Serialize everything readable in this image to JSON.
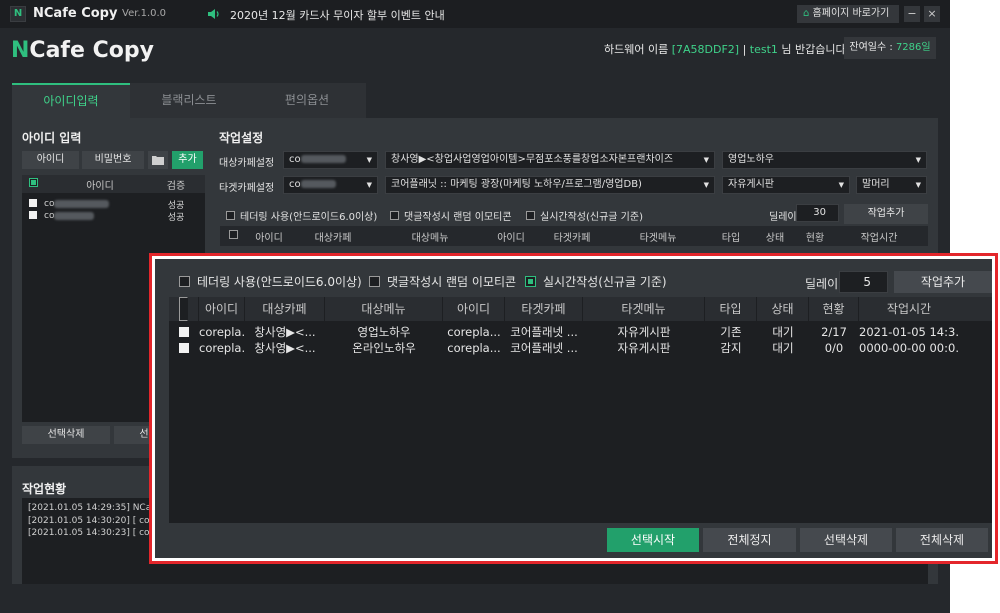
{
  "titlebar": {
    "app_name": "NCafe Copy",
    "version": "Ver.1.0.0",
    "notice": "2020년 12월 카드사 무이자 할부 이벤트 안내",
    "home_button": "홈페이지 바로가기",
    "minimize": "−",
    "close": "×",
    "logo_letter": "N"
  },
  "header": {
    "brand_n": "N",
    "brand_rest": "Cafe Copy",
    "hw_label": "하드웨어 이름 ",
    "hw_value": "[7A58DDF2]",
    "sep": " | ",
    "user_name": "test1",
    "greeting": " 님 반갑습니다!",
    "days_label": "잔여일수 : ",
    "days_value": "7286일"
  },
  "tabs": [
    "아이디입력",
    "블랙리스트",
    "편의옵션"
  ],
  "id_input": {
    "title": "아이디 입력",
    "id_button": "아이디",
    "pw_button": "비밀번호",
    "add_button": "추가",
    "col_id": "아이디",
    "col_verify": "검증",
    "rows": [
      {
        "id": "co",
        "status": "성공"
      },
      {
        "id": "co",
        "status": "성공"
      }
    ],
    "delete_selected": "선택삭제",
    "delete_all_partial": "선"
  },
  "job_settings": {
    "title": "작업설정",
    "target_cafe_label": "대상카페설정",
    "target_cafe_id": "co",
    "target_cafe_name": "창사영▶<창업사업영업아이템>무점포소풍를창업소자본프랜차이즈",
    "target_menu": "영업노하우",
    "dest_cafe_label": "타겟카페설정",
    "dest_cafe_id": "co",
    "dest_cafe_name": "코어플래닛 :: 마케팅 광장(마케팅 노하우/프로그램/영업DB)",
    "dest_board": "자유게시판",
    "dest_prefix": "말머리",
    "opt_tethering": "테더링 사용(안드로이드6.0이상)",
    "opt_emoticon": "댓글작성시 랜덤 이모티콘",
    "opt_realtime": "실시간작성(신규글 기준)",
    "delay_label": "딜레이",
    "delay_value": "30",
    "add_job": "작업추가",
    "table_headers": [
      "아이디",
      "대상카페",
      "대상메뉴",
      "아이디",
      "타겟카페",
      "타겟메뉴",
      "타입",
      "상태",
      "현황",
      "작업시간"
    ]
  },
  "status": {
    "title": "작업현황",
    "log": [
      "[2021.01.05 14:29:35]  NCaf",
      "[2021.01.05 14:30:20]  [ coi",
      "[2021.01.05 14:30:23]  [ co"
    ]
  },
  "zoom": {
    "opt_tethering": "테더링 사용(안드로이드6.0이상)",
    "opt_emoticon": "댓글작성시 랜덤 이모티콘",
    "opt_realtime": "실시간작성(신규글 기준)",
    "delay_label": "딜레이",
    "delay_value": "5",
    "add_job": "작업추가",
    "headers": [
      "아이디",
      "대상카페",
      "대상메뉴",
      "아이디",
      "타겟카페",
      "타겟메뉴",
      "타입",
      "상태",
      "현황",
      "작업시간"
    ],
    "rows": [
      [
        "corepla...",
        "창사영▶<...",
        "영업노하우",
        "corepla...",
        "코어플래넷 ...",
        "자유게시판",
        "기존",
        "대기",
        "2/17",
        "2021-01-05 14:3..."
      ],
      [
        "corepla...",
        "창사영▶<...",
        "온라인노하우",
        "corepla...",
        "코어플래넷 ...",
        "자유게시판",
        "감지",
        "대기",
        "0/0",
        "0000-00-00 00:0..."
      ]
    ],
    "btn_start": "선택시작",
    "btn_stop_all": "전체정지",
    "btn_delete_selected": "선택삭제",
    "btn_delete_all": "전체삭제"
  }
}
